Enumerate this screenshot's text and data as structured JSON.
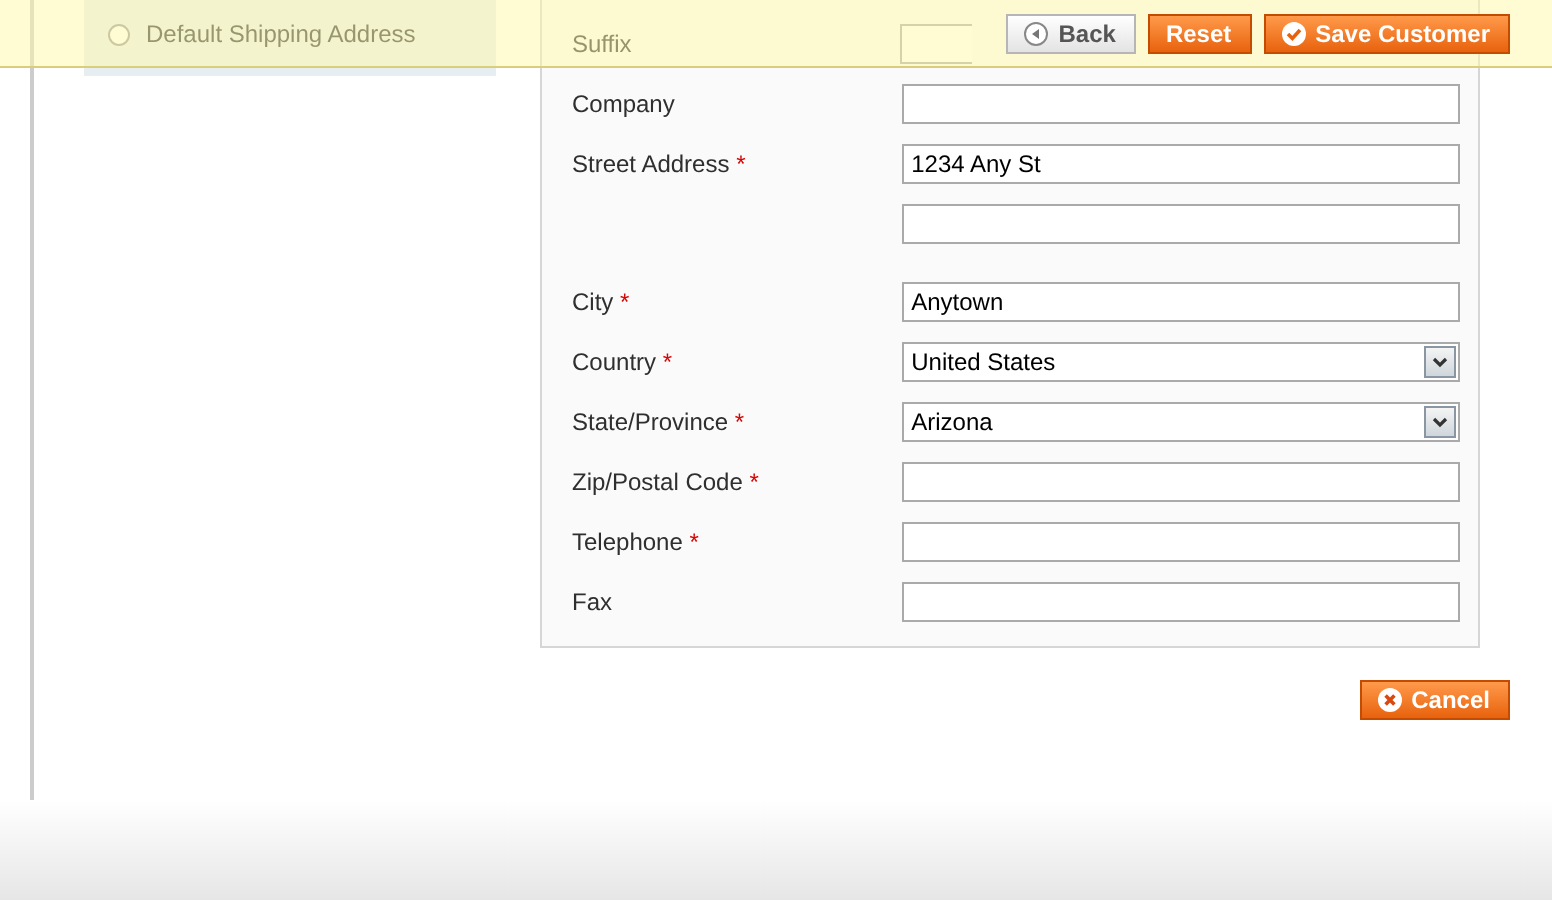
{
  "toolbar": {
    "buttons": [
      {
        "kind": "back",
        "label": "Back"
      },
      {
        "kind": "reset",
        "label": "Reset"
      },
      {
        "kind": "save",
        "label": "Save Customer"
      }
    ]
  },
  "sidebar": {
    "options": [
      {
        "label": "Default Shipping Address",
        "selected": false
      }
    ]
  },
  "form": {
    "rows": [
      {
        "label": "Suffix",
        "kind": "text",
        "value": ""
      },
      {
        "label": "Company",
        "kind": "text",
        "value": ""
      },
      {
        "label": "Street Address",
        "required_mark": "*",
        "kind": "text",
        "value": "1234 Any St"
      },
      {
        "label": "",
        "kind": "text",
        "value": ""
      },
      {
        "label": "City",
        "required_mark": "*",
        "kind": "text",
        "value": "Anytown"
      },
      {
        "label": "Country",
        "required_mark": "*",
        "kind": "select",
        "value": "United States"
      },
      {
        "label": "State/Province",
        "required_mark": "*",
        "kind": "select",
        "value": "Arizona"
      },
      {
        "label": "Zip/Postal Code",
        "required_mark": "*",
        "kind": "text",
        "value": ""
      },
      {
        "label": "Telephone",
        "required_mark": "*",
        "kind": "text",
        "value": ""
      },
      {
        "label": "Fax",
        "kind": "text",
        "value": ""
      }
    ]
  },
  "cancel_button": {
    "label": "Cancel"
  }
}
